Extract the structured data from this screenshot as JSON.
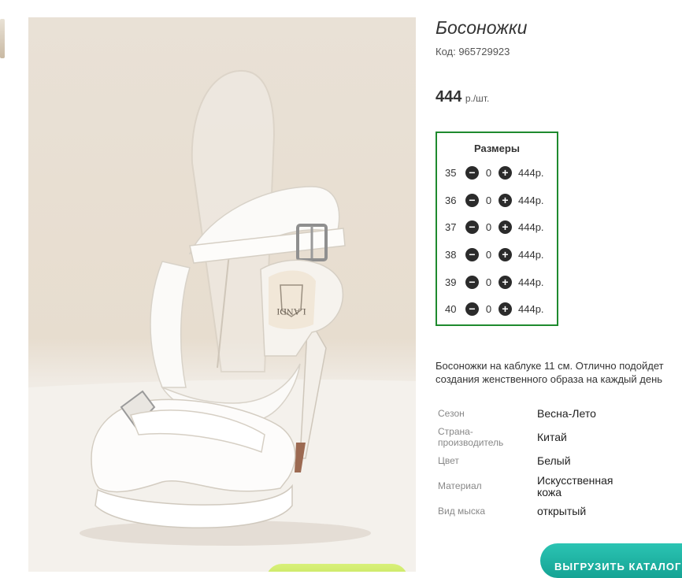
{
  "product": {
    "title": "Босоножки",
    "code_text": "Код: 965729923",
    "price_value": "444",
    "price_unit": "р./шт."
  },
  "photo": {
    "brand_text": "LANDI"
  },
  "sizes": {
    "title": "Размеры",
    "minus_icon": "minus-circle",
    "plus_icon": "plus-circle",
    "rows": [
      {
        "size": "35",
        "qty": "0",
        "price": "444р."
      },
      {
        "size": "36",
        "qty": "0",
        "price": "444р."
      },
      {
        "size": "37",
        "qty": "0",
        "price": "444р."
      },
      {
        "size": "38",
        "qty": "0",
        "price": "444р."
      },
      {
        "size": "39",
        "qty": "0",
        "price": "444р."
      },
      {
        "size": "40",
        "qty": "0",
        "price": "444р."
      }
    ]
  },
  "description": {
    "line1": "Босоножки на каблуке 11 см. Отлично подойдет",
    "line2": "создания женственного образа на каждый день"
  },
  "attributes": [
    {
      "label": "Сезон",
      "value": "Весна-Лето"
    },
    {
      "label": "Страна-производитель",
      "value": "Китай"
    },
    {
      "label": "Цвет",
      "value": "Белый"
    },
    {
      "label": "Материал",
      "value": "Искусственная кожа"
    },
    {
      "label": "Вид мыска",
      "value": "открытый"
    }
  ],
  "actions": {
    "export_label": "ВЫГРУЗИТЬ КАТАЛОГ"
  },
  "colors": {
    "sizes_border": "#1e8a2e",
    "export_button": "#1fb3a3",
    "photo_button": "#c8e65a"
  }
}
